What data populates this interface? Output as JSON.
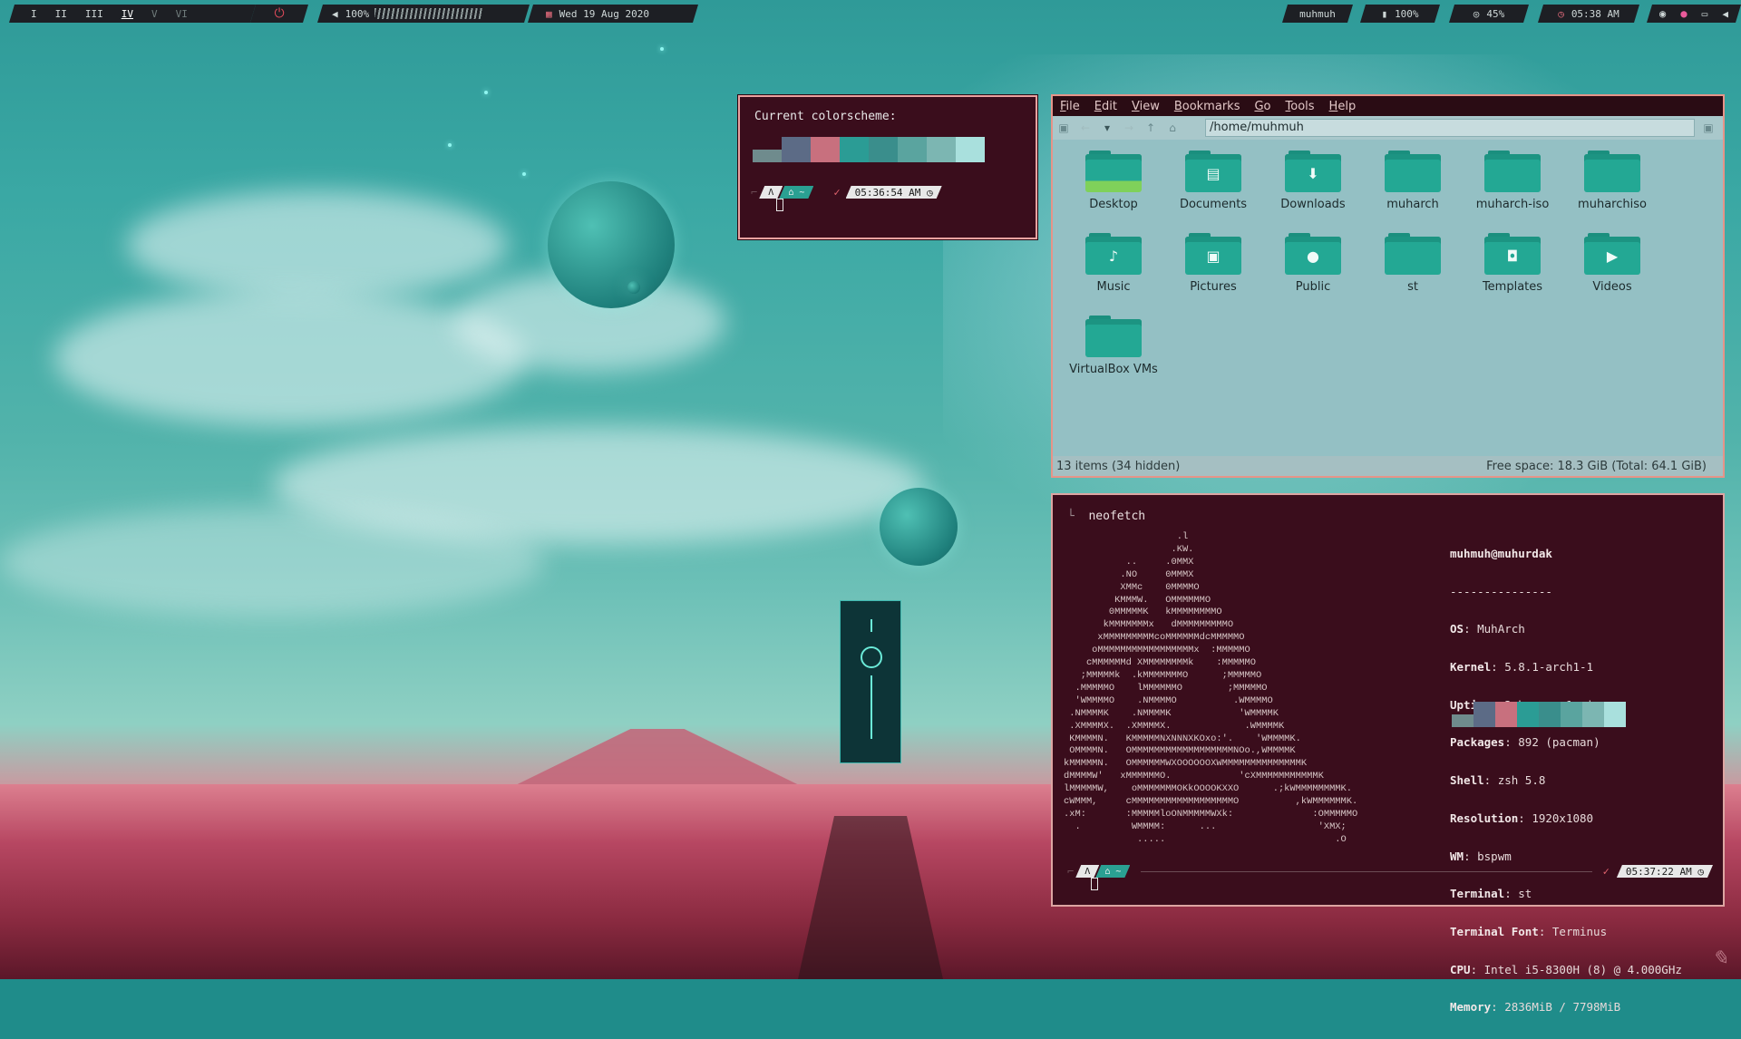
{
  "topbar": {
    "workspaces": [
      "I",
      "II",
      "III",
      "IV",
      "V",
      "VI"
    ],
    "active_workspace": "IV",
    "volume": "100%",
    "volume_level": 1.0,
    "date": "Wed 19 Aug 2020",
    "user": "muhmuh",
    "battery": "100%",
    "brightness": "45%",
    "time": "05:38 AM"
  },
  "colorscheme_window": {
    "title": "Current colorscheme:",
    "colors": [
      "#6f8b8d",
      "#5c6b86",
      "#c8707e",
      "#2b9c95",
      "#3a8e8c",
      "#5aa49f",
      "#7cb6b2",
      "#a9e0dd"
    ],
    "prompt_time": "05:36:54 AM",
    "prompt_dir": "~",
    "check": "✓"
  },
  "file_manager": {
    "menu": [
      "File",
      "Edit",
      "View",
      "Bookmarks",
      "Go",
      "Tools",
      "Help"
    ],
    "path": "/home/muhmuh",
    "items": [
      {
        "label": "Desktop",
        "icon": "desktop-folder-icon",
        "glyph": ""
      },
      {
        "label": "Documents",
        "icon": "documents-folder-icon",
        "glyph": "▤"
      },
      {
        "label": "Downloads",
        "icon": "downloads-folder-icon",
        "glyph": "⬇"
      },
      {
        "label": "muharch",
        "icon": "folder-icon",
        "glyph": ""
      },
      {
        "label": "muharch-iso",
        "icon": "folder-icon",
        "glyph": ""
      },
      {
        "label": "muharchiso",
        "icon": "folder-icon",
        "glyph": ""
      },
      {
        "label": "Music",
        "icon": "music-folder-icon",
        "glyph": "♪"
      },
      {
        "label": "Pictures",
        "icon": "pictures-folder-icon",
        "glyph": "▣"
      },
      {
        "label": "Public",
        "icon": "public-folder-icon",
        "glyph": "●"
      },
      {
        "label": "st",
        "icon": "folder-icon",
        "glyph": ""
      },
      {
        "label": "Templates",
        "icon": "templates-folder-icon",
        "glyph": "◘"
      },
      {
        "label": "Videos",
        "icon": "videos-folder-icon",
        "glyph": "▶"
      },
      {
        "label": "VirtualBox VMs",
        "icon": "folder-icon",
        "glyph": ""
      }
    ],
    "status_left": "13 items (34 hidden)",
    "status_right": "Free space: 18.3 GiB (Total: 64.1 GiB)"
  },
  "terminal": {
    "command": "neofetch",
    "host": "muhmuh@muhurdak",
    "separator": "---------------",
    "info": [
      {
        "key": "OS",
        "value": "MuhArch"
      },
      {
        "key": "Kernel",
        "value": "5.8.1-arch1-1"
      },
      {
        "key": "Uptime",
        "value": "2 hours, 1 min"
      },
      {
        "key": "Packages",
        "value": "892 (pacman)"
      },
      {
        "key": "Shell",
        "value": "zsh 5.8"
      },
      {
        "key": "Resolution",
        "value": "1920x1080"
      },
      {
        "key": "WM",
        "value": "bspwm"
      },
      {
        "key": "Terminal",
        "value": "st"
      },
      {
        "key": "Terminal Font",
        "value": "Terminus"
      },
      {
        "key": "CPU",
        "value": "Intel i5-8300H (8) @ 4.000GHz"
      },
      {
        "key": "Memory",
        "value": "2836MiB / 7798MiB"
      }
    ],
    "ascii_art": "                    .l\n                   .KW.\n           ..     .0MMX\n          .NO     0MMMX\n          XMMc    0MMMMO\n         KMMMW.   OMMMMMMO\n        0MMMMMK   kMMMMMMMMO\n       kMMMMMMMx   dMMMMMMMMMO\n      xMMMMMMMMMcoMMMMMMdcMMMMMO\n     oMMMMMMMMMMMMMMMMMx  :MMMMMO\n    cMMMMMMd XMMMMMMMMk    :MMMMMO\n   ;MMMMMk  .kMMMMMMMO      ;MMMMMO\n  .MMMMMO    lMMMMMMO        ;MMMMMO\n  'WMMMMO    .NMMMMO          .WMMMMO\n .NMMMMK    .NMMMMK            'WMMMMK\n .XMMMMX.  .XMMMMX.             .WMMMMK\n KMMMMN.   KMMMMMNXNNNXKOxo:'.    'WMMMMK.\n OMMMMN.   OMMMMMMMMMMMMMMMMMMNOo.,WMMMMK\nkMMMMMN.   OMMMMMMWXOOOOOOXWMMMMMMMMMMMMMMK\ndMMMMW'   xMMMMMMO.            'cXMMMMMMMMMMMK\nlMMMMMW,    oMMMMMMMOKkOOOOKXXO      .;kWMMMMMMMMK.\ncWMMM,     cMMMMMMMMMMMMMMMMMMO          ,kWMMMMMMK.\n.xM:       :MMMMMloONMMMMMWXk:              :OMMMMMO\n  .         WMMMM:      ...                  'XMX;\n             .....                              .O",
    "prompt_time": "05:37:22 AM",
    "prompt_dir": "~",
    "check": "✓"
  }
}
